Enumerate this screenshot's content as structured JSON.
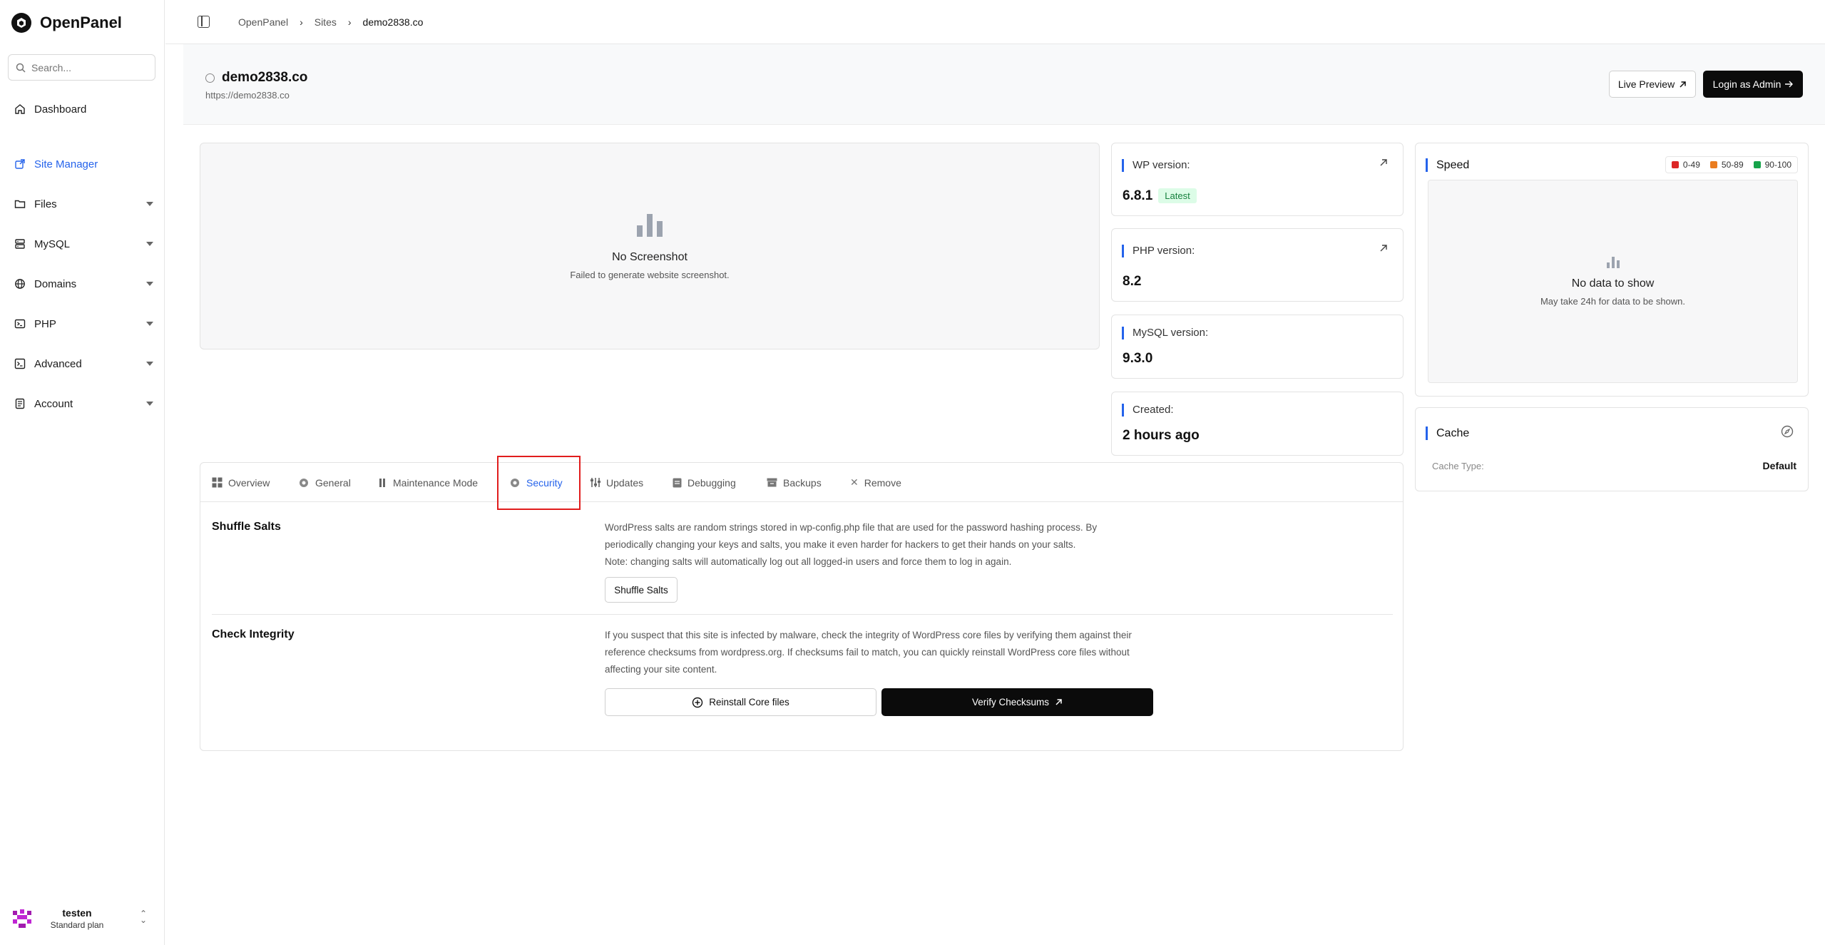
{
  "brand": {
    "name": "OpenPanel"
  },
  "search": {
    "placeholder": "Search..."
  },
  "nav": {
    "dashboard": "Dashboard",
    "site_manager": "Site Manager",
    "files": "Files",
    "mysql": "MySQL",
    "domains": "Domains",
    "php": "PHP",
    "advanced": "Advanced",
    "account": "Account"
  },
  "user": {
    "name": "testen",
    "plan": "Standard plan"
  },
  "breadcrumb": [
    "OpenPanel",
    "Sites",
    "demo2838.co"
  ],
  "site": {
    "name": "demo2838.co",
    "url": "https://demo2838.co",
    "live_preview": "Live Preview",
    "login_admin": "Login as Admin"
  },
  "screenshot": {
    "title": "No Screenshot",
    "subtitle": "Failed to generate website screenshot."
  },
  "info": {
    "wp_label": "WP version:",
    "wp_value": "6.8.1",
    "wp_badge": "Latest",
    "php_label": "PHP version:",
    "php_value": "8.2",
    "mysql_label": "MySQL version:",
    "mysql_value": "9.3.0",
    "created_label": "Created:",
    "created_value": "2 hours ago"
  },
  "speed": {
    "title": "Speed",
    "legend": [
      {
        "label": "0-49",
        "color": "#dc2626"
      },
      {
        "label": "50-89",
        "color": "#ea7c1f"
      },
      {
        "label": "90-100",
        "color": "#16a34a"
      }
    ],
    "empty_title": "No data to show",
    "empty_sub": "May take 24h for data to be shown."
  },
  "cache": {
    "title": "Cache",
    "type_label": "Cache Type:",
    "type_value": "Default"
  },
  "tabs": [
    "Overview",
    "General",
    "Maintenance Mode",
    "Security",
    "Updates",
    "Debugging",
    "Backups",
    "Remove"
  ],
  "active_tab": "Security",
  "security": {
    "shuffle_title": "Shuffle Salts",
    "shuffle_desc_1": "WordPress salts are random strings stored in wp-config.php file that are used for the password hashing process. By",
    "shuffle_desc_2": "periodically changing your keys and salts, you make it even harder for hackers to get their hands on your salts.",
    "shuffle_desc_3": "Note: changing salts will automatically log out all logged-in users and force them to log in again.",
    "shuffle_button": "Shuffle Salts",
    "integrity_title": "Check Integrity",
    "integrity_desc_1": "If you suspect that this site is infected by malware, check the integrity of WordPress core files by verifying them against their",
    "integrity_desc_2": "reference checksums from wordpress.org. If checksums fail to match, you can quickly reinstall WordPress core files without",
    "integrity_desc_3": "affecting your site content.",
    "reinstall_button": "Reinstall Core files",
    "verify_button": "Verify Checksums"
  }
}
